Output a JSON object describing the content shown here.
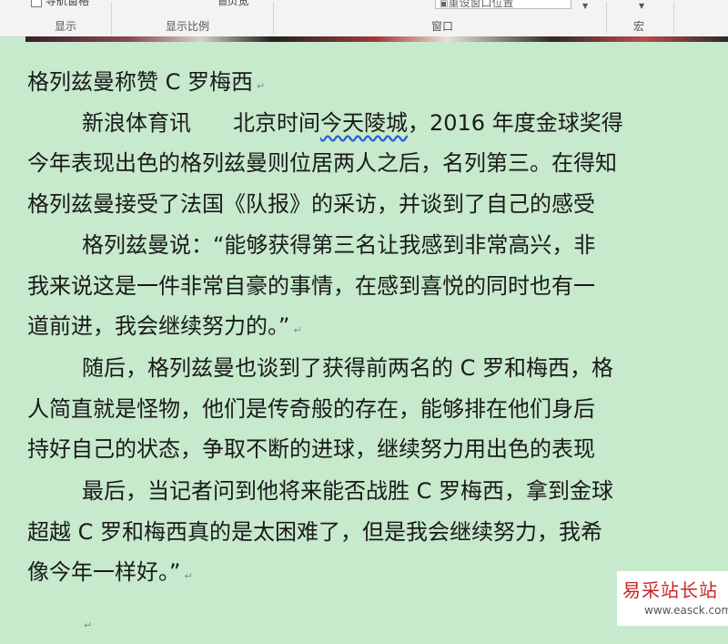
{
  "ribbon": {
    "nav_pane_label": "导航窗格",
    "page_width_label": "页宽",
    "window_position_value": "重设窗口位置",
    "groups": {
      "display": "显示",
      "zoom": "显示比例",
      "window": "窗口",
      "macro": "宏"
    }
  },
  "document": {
    "title": "格列兹曼称赞 C 罗梅西",
    "lines": {
      "l1a": "新浪体育讯",
      "l1b_pre": "北京时间",
      "l1b_spell": "今天陵城",
      "l1b_post": "，2016 年度金球奖得",
      "l2": "今年表现出色的格列兹曼则位居两人之后，名列第三。在得知",
      "l3": "格列兹曼接受了法国《队报》的采访，并谈到了自己的感受",
      "l4": "格列兹曼说：“能够获得第三名让我感到非常高兴，非",
      "l5": "我来说这是一件非常自豪的事情，在感到喜悦的同时也有一",
      "l6": "道前进，我会继续努力的。”",
      "l7": "随后，格列兹曼也谈到了获得前两名的 C 罗和梅西，格",
      "l8": "人简直就是怪物，他们是传奇般的存在，能够排在他们身后",
      "l9": "持好自己的状态，争取不断的进球，继续努力用出色的表现",
      "l10": "最后，当记者问到他将来能否战胜 C 罗梅西，拿到金球",
      "l11": "超越 C 罗和梅西真的是太困难了，但是我会继续努力，我希",
      "l12": "像今年一样好。”"
    },
    "paragraph_mark": "↵"
  },
  "watermark": {
    "cn": "易采站长站",
    "en": "www.easck.com"
  }
}
